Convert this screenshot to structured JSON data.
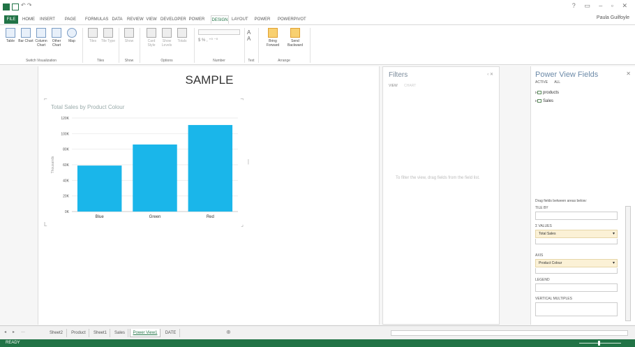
{
  "app": {
    "window_title": "",
    "user": "Paula Guilfoyle"
  },
  "ribbon_tabs": [
    {
      "label": "FILE",
      "kind": "file"
    },
    {
      "label": "HOME"
    },
    {
      "label": "INSERT"
    },
    {
      "label": "PAGE LAYOUT"
    },
    {
      "label": "FORMULAS"
    },
    {
      "label": "DATA"
    },
    {
      "label": "REVIEW"
    },
    {
      "label": "VIEW"
    },
    {
      "label": "DEVELOPER"
    },
    {
      "label": "POWER VIEW"
    },
    {
      "label": "DESIGN",
      "active": true
    },
    {
      "label": "LAYOUT"
    },
    {
      "label": "POWER QUERY"
    },
    {
      "label": "POWERPIVOT"
    }
  ],
  "ribbon": {
    "switch_visualization": {
      "buttons": [
        "Table",
        "Bar Chart",
        "Column Chart",
        "Other Chart",
        "Map"
      ],
      "label": "Switch Visualization"
    },
    "tiles": {
      "buttons": [
        "Tiles",
        "Tile Type"
      ],
      "label": "Tiles"
    },
    "show": {
      "buttons": [
        "Show"
      ],
      "label": "Show"
    },
    "options": {
      "buttons": [
        "Card Style",
        "Show Levels",
        "Totals"
      ],
      "label": "Options"
    },
    "number": {
      "label": "Number"
    },
    "text": {
      "label": "Text"
    },
    "arrange": {
      "buttons": [
        "Bring Forward",
        "Send Backward"
      ],
      "label": "Arrange"
    }
  },
  "canvas": {
    "title": "SAMPLE"
  },
  "chart_data": {
    "type": "bar",
    "title": "Total Sales by Product Colour",
    "categories": [
      "Blue",
      "Green",
      "Red"
    ],
    "values": [
      59,
      86,
      111
    ],
    "ylabel": "Thousands",
    "ylim": [
      0,
      120
    ],
    "yticks": [
      {
        "value": 0,
        "label": "0K"
      },
      {
        "value": 20,
        "label": "20K"
      },
      {
        "value": 40,
        "label": "40K"
      },
      {
        "value": 60,
        "label": "60K"
      },
      {
        "value": 80,
        "label": "80K"
      },
      {
        "value": 100,
        "label": "100K"
      },
      {
        "value": 120,
        "label": "120K"
      }
    ],
    "bar_color": "#1ab6ea",
    "grid": true
  },
  "filters": {
    "title": "Filters",
    "tabs": [
      "VIEW",
      "CHART"
    ],
    "message": "To filter the view, drag fields from the field list."
  },
  "fields": {
    "title": "Power View Fields",
    "tabs": [
      "ACTIVE",
      "ALL"
    ],
    "tables": [
      "products",
      "Sales"
    ],
    "drag_hint": "Drag fields between areas below:",
    "tile_by_label": "TILE BY",
    "values_label": "Σ VALUES",
    "values_item": "Total Sales",
    "axis_label": "AXIS",
    "axis_item": "Product Colour",
    "legend_label": "LEGEND",
    "vertical_label": "VERTICAL MULTIPLES"
  },
  "sheets": [
    "Sheet2",
    "Product",
    "Sheet1",
    "Sales",
    "Power View1",
    "DATE"
  ],
  "active_sheet": "Power View1",
  "status": "READY",
  "colors": {
    "accent": "#217346",
    "bar": "#1ab6ea"
  }
}
